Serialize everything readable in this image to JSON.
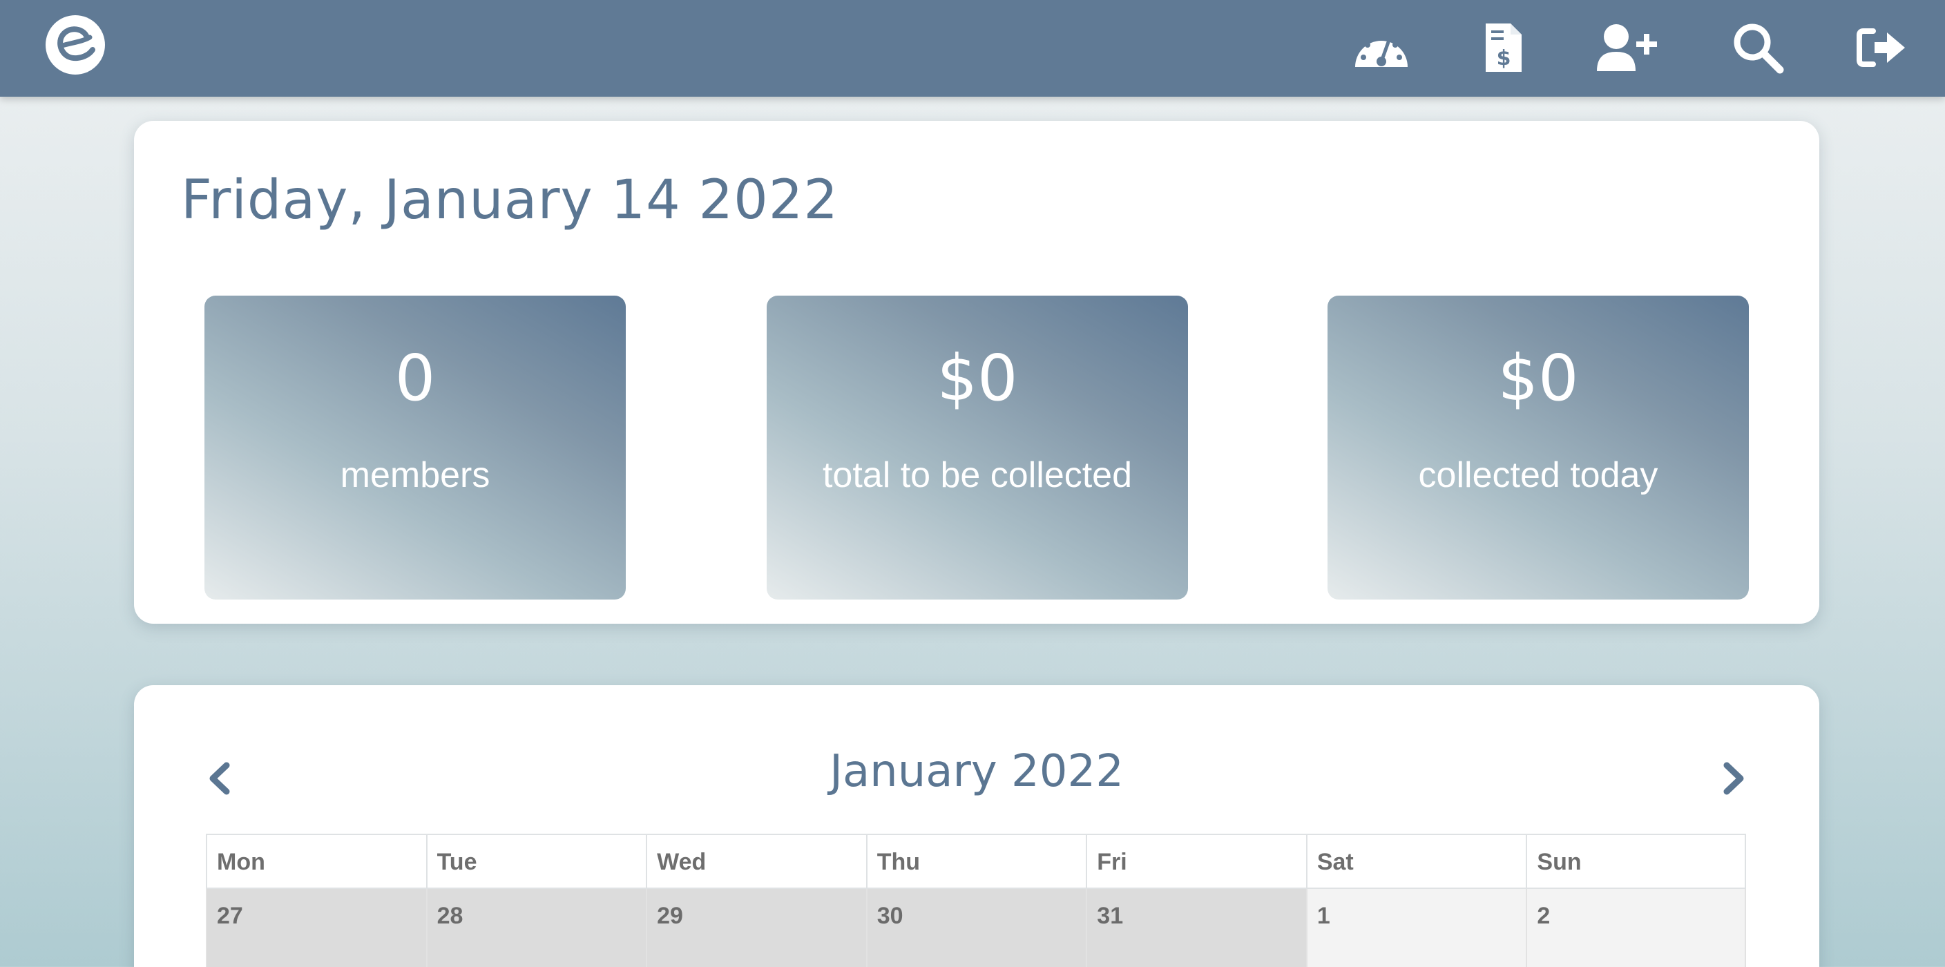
{
  "header": {
    "logo_name": "app-logo",
    "nav": [
      {
        "name": "dashboard-icon",
        "title": "Dashboard"
      },
      {
        "name": "invoice-icon",
        "title": "Invoice"
      },
      {
        "name": "add-user-icon",
        "title": "Add member"
      },
      {
        "name": "search-icon",
        "title": "Search"
      },
      {
        "name": "logout-icon",
        "title": "Log out"
      }
    ],
    "color": "#607a95"
  },
  "summary": {
    "date": "Friday, January 14 2022",
    "stats": [
      {
        "value": "0",
        "label": "members"
      },
      {
        "value": "$0",
        "label": "total to be collected"
      },
      {
        "value": "$0",
        "label": "collected today"
      }
    ]
  },
  "calendar": {
    "month": "January 2022",
    "weekdays": [
      "Mon",
      "Tue",
      "Wed",
      "Thu",
      "Fri",
      "Sat",
      "Sun"
    ],
    "first_row": [
      {
        "day": "27",
        "in_month": false
      },
      {
        "day": "28",
        "in_month": false
      },
      {
        "day": "29",
        "in_month": false
      },
      {
        "day": "30",
        "in_month": false
      },
      {
        "day": "31",
        "in_month": false
      },
      {
        "day": "1",
        "in_month": true
      },
      {
        "day": "2",
        "in_month": true
      }
    ]
  },
  "colors": {
    "accent": "#5b7692",
    "out_of_month_cell": "#dcdcdc",
    "in_month_cell": "#f3f3f3"
  }
}
